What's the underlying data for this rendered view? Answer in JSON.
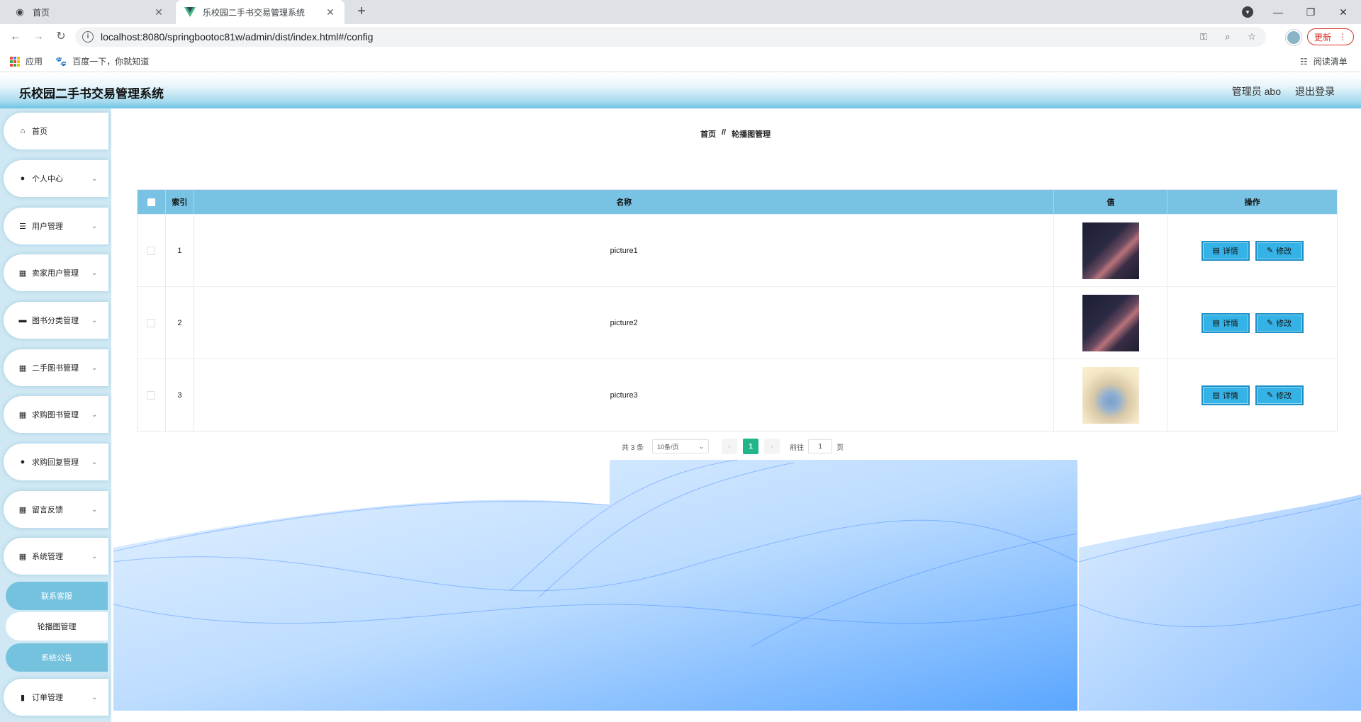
{
  "browser": {
    "tabs": [
      {
        "title": "首页",
        "icon": "globe-icon"
      },
      {
        "title": "乐校园二手书交易管理系统",
        "icon": "vue-logo-icon"
      }
    ],
    "url": "localhost:8080/springbootoc81w/admin/dist/index.html#/config",
    "update_label": "更新",
    "bookmarks": [
      {
        "label": "应用",
        "icon": "apps-grid-icon"
      },
      {
        "label": "百度一下，你就知道",
        "icon": "baidu-paw-icon"
      }
    ],
    "reading_list": "阅读清单"
  },
  "header": {
    "title": "乐校园二手书交易管理系统",
    "user": "管理员 abo",
    "logout": "退出登录"
  },
  "sidebar": {
    "items": [
      {
        "label": "首页",
        "icon": "home-icon"
      },
      {
        "label": "个人中心",
        "icon": "user-icon"
      },
      {
        "label": "用户管理",
        "icon": "sliders-icon"
      },
      {
        "label": "卖家用户管理",
        "icon": "grid-icon"
      },
      {
        "label": "图书分类管理",
        "icon": "briefcase-icon"
      },
      {
        "label": "二手图书管理",
        "icon": "grid-icon"
      },
      {
        "label": "求购图书管理",
        "icon": "grid-icon"
      },
      {
        "label": "求购回复管理",
        "icon": "user-icon"
      },
      {
        "label": "留言反馈",
        "icon": "grid-icon"
      },
      {
        "label": "系统管理",
        "icon": "grid-icon"
      },
      {
        "label": "订单管理",
        "icon": "bar-chart-icon"
      }
    ],
    "sub_items": [
      {
        "label": "联系客服"
      },
      {
        "label": "轮播图管理"
      },
      {
        "label": "系统公告"
      }
    ]
  },
  "breadcrumb": {
    "home": "首页",
    "separator": "//",
    "current": "轮播图管理"
  },
  "table": {
    "columns": [
      "索引",
      "名称",
      "值",
      "操作"
    ],
    "rows": [
      {
        "index": "1",
        "name": "picture1"
      },
      {
        "index": "2",
        "name": "picture2"
      },
      {
        "index": "3",
        "name": "picture3"
      }
    ],
    "detail_label": "详情",
    "edit_label": "修改"
  },
  "pagination": {
    "total": "共 3 条",
    "page_size": "10条/页",
    "current_page": "1",
    "goto_label": "前往",
    "goto_value": "1",
    "page_suffix": "页"
  },
  "colors": {
    "table_header": "#78c3e3",
    "active_page": "#21b68a",
    "button": "#36b3e6"
  }
}
